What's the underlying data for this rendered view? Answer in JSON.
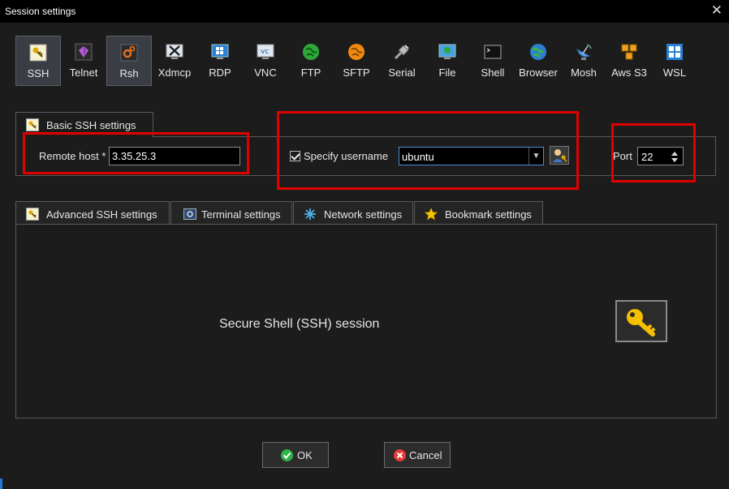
{
  "window": {
    "title": "Session settings",
    "close_glyph": "✕"
  },
  "session_types": [
    {
      "label": "SSH",
      "icon": "key-icon",
      "active": true
    },
    {
      "label": "Telnet",
      "icon": "gem-icon",
      "active": false
    },
    {
      "label": "Rsh",
      "icon": "gear-icon",
      "active": true
    },
    {
      "label": "Xdmcp",
      "icon": "x-display-icon",
      "active": false
    },
    {
      "label": "RDP",
      "icon": "windows-monitor-icon",
      "active": false
    },
    {
      "label": "VNC",
      "icon": "vnc-monitor-icon",
      "active": false
    },
    {
      "label": "FTP",
      "icon": "globe-green-icon",
      "active": false
    },
    {
      "label": "SFTP",
      "icon": "globe-orange-icon",
      "active": false
    },
    {
      "label": "Serial",
      "icon": "plug-icon",
      "active": false
    },
    {
      "label": "File",
      "icon": "file-monitor-icon",
      "active": false
    },
    {
      "label": "Shell",
      "icon": "terminal-icon",
      "active": false
    },
    {
      "label": "Browser",
      "icon": "globe-blue-icon",
      "active": false
    },
    {
      "label": "Mosh",
      "icon": "satellite-dish-icon",
      "active": false
    },
    {
      "label": "Aws S3",
      "icon": "aws-cubes-icon",
      "active": false
    },
    {
      "label": "WSL",
      "icon": "windows-logo-icon",
      "active": false
    }
  ],
  "basic": {
    "tab_label": "Basic SSH settings",
    "remote_host_label": "Remote host *",
    "remote_host_value": "3.35.25.3",
    "specify_username_label": "Specify username",
    "specify_username_checked": true,
    "username_value": "ubuntu",
    "port_label": "Port",
    "port_value": "22"
  },
  "lower_tabs": [
    {
      "label": "Advanced SSH settings",
      "icon": "key-icon"
    },
    {
      "label": "Terminal settings",
      "icon": "terminal-settings-icon"
    },
    {
      "label": "Network settings",
      "icon": "network-icon"
    },
    {
      "label": "Bookmark settings",
      "icon": "star-icon"
    }
  ],
  "session_description": "Secure Shell (SSH) session",
  "buttons": {
    "ok_label": "OK",
    "cancel_label": "Cancel"
  },
  "colors": {
    "highlight_red": "#e00000",
    "accent_blue": "#4a90d9",
    "key_gold": "#f5c000"
  }
}
